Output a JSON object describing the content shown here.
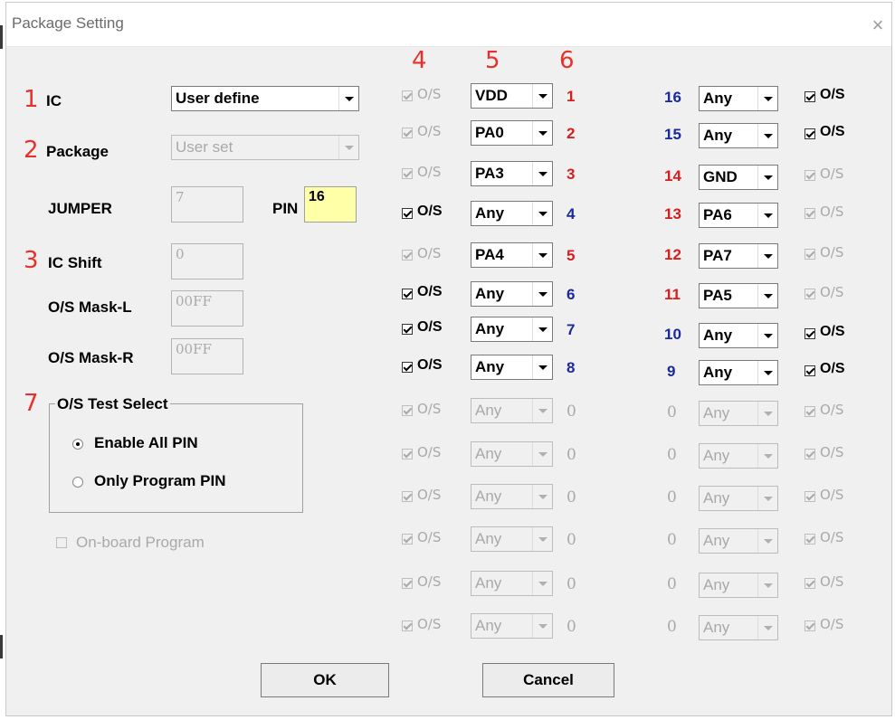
{
  "window": {
    "title": "Package Setting",
    "close_glyph": "×",
    "close_icon": "close-icon"
  },
  "callouts": {
    "n1": "1",
    "n2": "2",
    "n3": "3",
    "n4": "4",
    "n5": "5",
    "n6": "6",
    "n7": "7"
  },
  "left": {
    "ic_label": "IC",
    "ic_value": "User define",
    "package_label": "Package",
    "package_value": "User set",
    "jumper_label": "JUMPER",
    "jumper_value": "7",
    "pin_label": "PIN",
    "pin_value": "16",
    "ic_shift_label": "IC Shift",
    "ic_shift_value": "0",
    "mask_l_label": "O/S Mask-L",
    "mask_l_value": "00FF",
    "mask_r_label": "O/S Mask-R",
    "mask_r_value": "00FF",
    "group_title": "O/S Test Select",
    "radio_all": "Enable All PIN",
    "radio_all_selected": true,
    "radio_prog": "Only Program PIN",
    "radio_prog_selected": false,
    "onboard_label": "On-board Program",
    "onboard_checked": false
  },
  "os_label": "O/S",
  "left_pins": [
    {
      "check": "disabled",
      "sel": "VDD",
      "sel_enabled": true,
      "num": "1",
      "num_color": "red"
    },
    {
      "check": "disabled",
      "sel": "PA0",
      "sel_enabled": true,
      "num": "2",
      "num_color": "red"
    },
    {
      "check": "disabled",
      "sel": "PA3",
      "sel_enabled": true,
      "num": "3",
      "num_color": "red"
    },
    {
      "check": "checked",
      "sel": "Any",
      "sel_enabled": true,
      "num": "4",
      "num_color": "blue"
    },
    {
      "check": "disabled",
      "sel": "PA4",
      "sel_enabled": true,
      "num": "5",
      "num_color": "red"
    },
    {
      "check": "checked",
      "sel": "Any",
      "sel_enabled": true,
      "num": "6",
      "num_color": "blue"
    },
    {
      "check": "checked",
      "sel": "Any",
      "sel_enabled": true,
      "num": "7",
      "num_color": "blue"
    },
    {
      "check": "checked",
      "sel": "Any",
      "sel_enabled": true,
      "num": "8",
      "num_color": "blue"
    },
    {
      "check": "disabled",
      "sel": "Any",
      "sel_enabled": false,
      "num": "0",
      "num_color": "gray"
    },
    {
      "check": "disabled",
      "sel": "Any",
      "sel_enabled": false,
      "num": "0",
      "num_color": "gray"
    },
    {
      "check": "disabled",
      "sel": "Any",
      "sel_enabled": false,
      "num": "0",
      "num_color": "gray"
    },
    {
      "check": "disabled",
      "sel": "Any",
      "sel_enabled": false,
      "num": "0",
      "num_color": "gray"
    },
    {
      "check": "disabled",
      "sel": "Any",
      "sel_enabled": false,
      "num": "0",
      "num_color": "gray"
    },
    {
      "check": "disabled",
      "sel": "Any",
      "sel_enabled": false,
      "num": "0",
      "num_color": "gray"
    }
  ],
  "right_pins": [
    {
      "num": "16",
      "num_color": "blue",
      "sel": "Any",
      "sel_enabled": true,
      "check": "checked"
    },
    {
      "num": "15",
      "num_color": "blue",
      "sel": "Any",
      "sel_enabled": true,
      "check": "checked"
    },
    {
      "num": "14",
      "num_color": "red",
      "sel": "GND",
      "sel_enabled": true,
      "check": "disabled"
    },
    {
      "num": "13",
      "num_color": "red",
      "sel": "PA6",
      "sel_enabled": true,
      "check": "disabled"
    },
    {
      "num": "12",
      "num_color": "red",
      "sel": "PA7",
      "sel_enabled": true,
      "check": "disabled"
    },
    {
      "num": "11",
      "num_color": "red",
      "sel": "PA5",
      "sel_enabled": true,
      "check": "disabled"
    },
    {
      "num": "10",
      "num_color": "blue",
      "sel": "Any",
      "sel_enabled": true,
      "check": "checked"
    },
    {
      "num": "9",
      "num_color": "blue",
      "sel": "Any",
      "sel_enabled": true,
      "check": "checked"
    },
    {
      "num": "0",
      "num_color": "gray",
      "sel": "Any",
      "sel_enabled": false,
      "check": "disabled"
    },
    {
      "num": "0",
      "num_color": "gray",
      "sel": "Any",
      "sel_enabled": false,
      "check": "disabled"
    },
    {
      "num": "0",
      "num_color": "gray",
      "sel": "Any",
      "sel_enabled": false,
      "check": "disabled"
    },
    {
      "num": "0",
      "num_color": "gray",
      "sel": "Any",
      "sel_enabled": false,
      "check": "disabled"
    },
    {
      "num": "0",
      "num_color": "gray",
      "sel": "Any",
      "sel_enabled": false,
      "check": "disabled"
    },
    {
      "num": "0",
      "num_color": "gray",
      "sel": "Any",
      "sel_enabled": false,
      "check": "disabled"
    }
  ],
  "buttons": {
    "ok": "OK",
    "cancel": "Cancel"
  },
  "colors": {
    "callout": "#e8312b",
    "pin_red": "#d22020",
    "pin_blue": "#1a2a9a",
    "disabled": "#a9a9a9",
    "pin_field_bg": "#ffffa8"
  }
}
